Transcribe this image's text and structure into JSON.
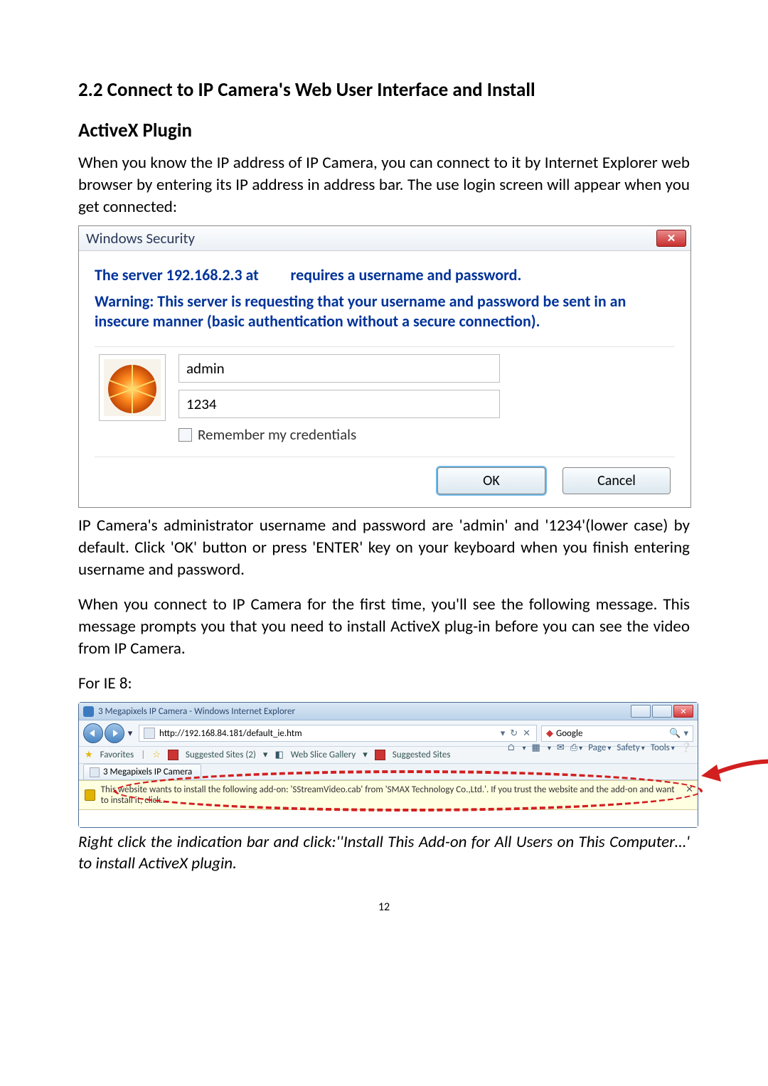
{
  "section_title": "2.2 Connect to IP Camera's Web User Interface and Install",
  "sub_title": "ActiveX Plugin",
  "intro_para": "When you know the IP address of IP Camera, you can connect to it by Internet Explorer web browser by entering its IP address in address bar. The use login screen will appear when you get connected:",
  "dialog": {
    "title": "Windows Security",
    "heading_left": "The server 192.168.2.3 at",
    "heading_right": "requires a username and password.",
    "warning": "Warning: This server is requesting that your username and password be sent in an insecure manner (basic authentication without a secure connection).",
    "username_value": "admin",
    "password_value": "1234",
    "remember_label": "Remember my credentials",
    "ok_label": "OK",
    "cancel_label": "Cancel"
  },
  "para_after_dialog": "IP Camera's administrator username and password are 'admin' and '1234'(lower case) by default. Click 'OK' button or press 'ENTER' key on your keyboard when you finish entering username and password.",
  "para_first_time": "When you connect to IP Camera for the first time, you'll see the following message. This message prompts you that you need to install ActiveX plug-in before you can see the video from IP Camera.",
  "for_ie8_label": "For IE 8:",
  "ie8": {
    "window_title": "3 Megapixels IP Camera - Windows Internet Explorer",
    "address_value": "http://192.168.84.181/default_ie.htm",
    "search_placeholder": "Google",
    "fav_label": "Favorites",
    "suggested1": "Suggested Sites (2)",
    "webslice": "Web Slice Gallery",
    "suggested2": "Suggested Sites",
    "tab_label": "3 Megapixels IP Camera",
    "cmd_page": "Page",
    "cmd_safety": "Safety",
    "cmd_tools": "Tools",
    "infobar_text": "This website wants to install the following add-on: 'SStreamVideo.cab' from 'SMAX Technology Co.,Ltd.'. If you trust the website and the add-on and want to install it, click…"
  },
  "caption": "Right click the indication bar and click:''Install This Add-on for All Users on This Computer…' to install ActiveX plugin.",
  "page_number": "12"
}
